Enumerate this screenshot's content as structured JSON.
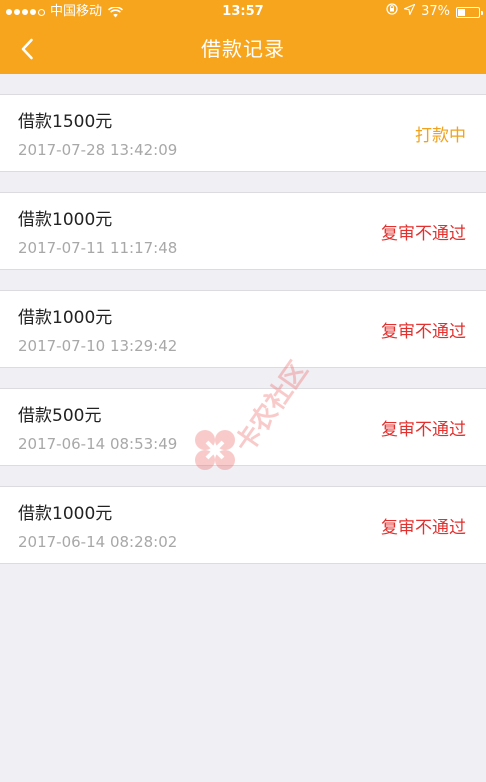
{
  "status_bar": {
    "carrier": "中国移动",
    "time": "13:57",
    "battery": "37%",
    "battery_level": 0.37
  },
  "navbar": {
    "back_icon": "chevron-left-icon",
    "title": "借款记录"
  },
  "records": [
    {
      "amount": "借款1500元",
      "time": "2017-07-28 13:42:09",
      "status": "打款中",
      "status_color": "#f0a31c"
    },
    {
      "amount": "借款1000元",
      "time": "2017-07-11 11:17:48",
      "status": "复审不通过",
      "status_color": "#e2312e"
    },
    {
      "amount": "借款1000元",
      "time": "2017-07-10 13:29:42",
      "status": "复审不通过",
      "status_color": "#e2312e"
    },
    {
      "amount": "借款500元",
      "time": "2017-06-14 08:53:49",
      "status": "复审不通过",
      "status_color": "#e2312e"
    },
    {
      "amount": "借款1000元",
      "time": "2017-06-14 08:28:02",
      "status": "复审不通过",
      "status_color": "#e2312e"
    }
  ],
  "watermark": {
    "text": "卡农社区"
  },
  "colors": {
    "header": "#f7a51d",
    "background": "#efeff4"
  }
}
